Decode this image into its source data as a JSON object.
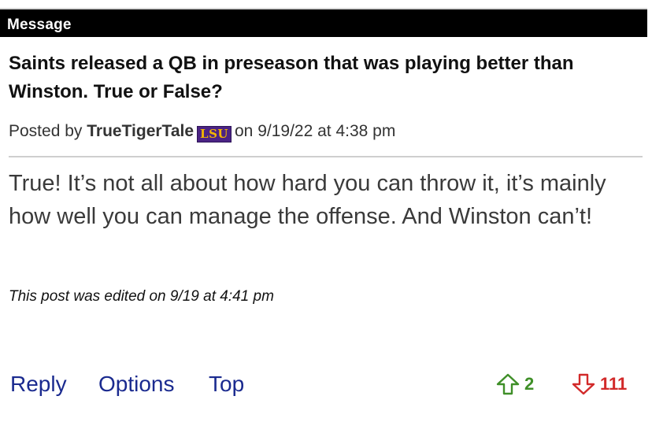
{
  "header": {
    "label": "Message"
  },
  "post": {
    "title": "Saints released a QB in preseason that was playing better than Winston. True or False?",
    "byline_prefix": "Posted by",
    "author": "TrueTigerTale",
    "team_badge": "LSU",
    "byline_middle": "on",
    "timestamp": "9/19/22 at 4:38 pm",
    "body": "True! It’s not all about how hard you can throw it, it’s mainly how well you can manage the offense. And Winston can’t!",
    "edited_note": "This post was edited on 9/19 at 4:41 pm"
  },
  "actions": {
    "reply_label": "Reply",
    "options_label": "Options",
    "top_label": "Top"
  },
  "votes": {
    "up_count": "2",
    "down_count": "111",
    "up_icon": "arrow-up-icon",
    "down_icon": "arrow-down-icon",
    "up_color": "#3f8f28",
    "down_color": "#d22a2a"
  },
  "colors": {
    "header_bg": "#000000",
    "link": "#1a2a8f",
    "badge_bg": "#4b2384",
    "badge_fg": "#f2b600"
  }
}
